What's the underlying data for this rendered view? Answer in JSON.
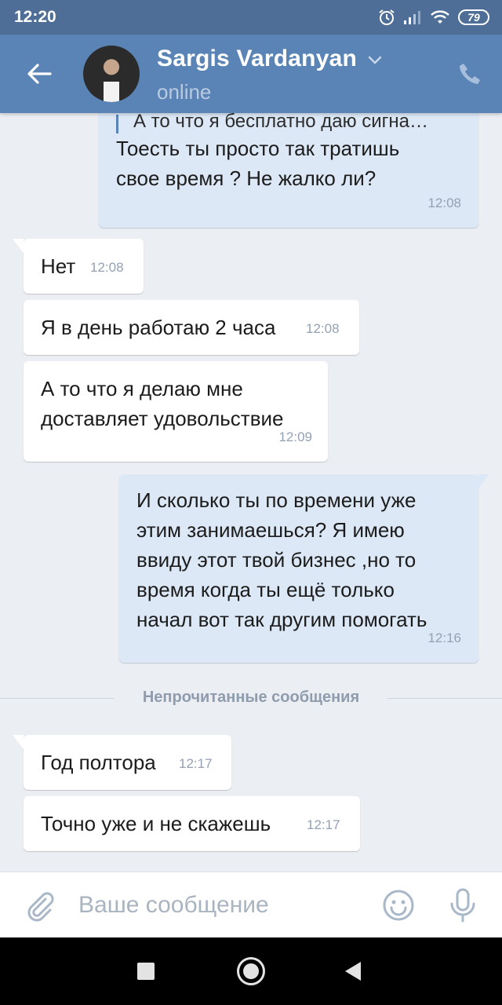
{
  "status_bar": {
    "time": "12:20",
    "battery": "79"
  },
  "header": {
    "contact_name": "Sargis Vardanyan",
    "contact_status": "online"
  },
  "messages": [
    {
      "direction": "out",
      "reply_preview": "А то что я бесплатно даю сигна…",
      "text": "Тоесть ты просто так тратишь\nсвое время ? Не жалко ли?",
      "time": "12:08"
    },
    {
      "direction": "in",
      "text": "Нет",
      "time": "12:08"
    },
    {
      "direction": "in",
      "text": "Я в день работаю 2 часа",
      "time": "12:08"
    },
    {
      "direction": "in",
      "text": "А то что я делаю мне\nдоставляет удовольствие",
      "time": "12:09"
    },
    {
      "direction": "out",
      "text": "И сколько ты по времени уже\nэтим занимаешься? Я имею\nввиду этот твой бизнес ,но то\nвремя когда ты ещё только\nначал вот так другим помогать",
      "time": "12:16"
    },
    {
      "direction": "in",
      "text": "Год полтора",
      "time": "12:17"
    },
    {
      "direction": "in",
      "text": "Точно уже и не скажешь",
      "time": "12:17"
    }
  ],
  "unread_divider": "Непрочитанные сообщения",
  "composer": {
    "placeholder": "Ваше сообщение",
    "value": ""
  },
  "colors": {
    "header": "#5b84b6",
    "status_bar": "#4e6e97",
    "outgoing_bubble": "#dce8f6",
    "incoming_bubble": "#ffffff",
    "chat_background": "#ebeef2"
  },
  "icons": [
    "back-arrow-icon",
    "chevron-down-icon",
    "phone-icon",
    "paperclip-icon",
    "emoji-icon",
    "microphone-icon",
    "alarm-icon",
    "signal-icon",
    "wifi-icon",
    "battery-icon"
  ]
}
